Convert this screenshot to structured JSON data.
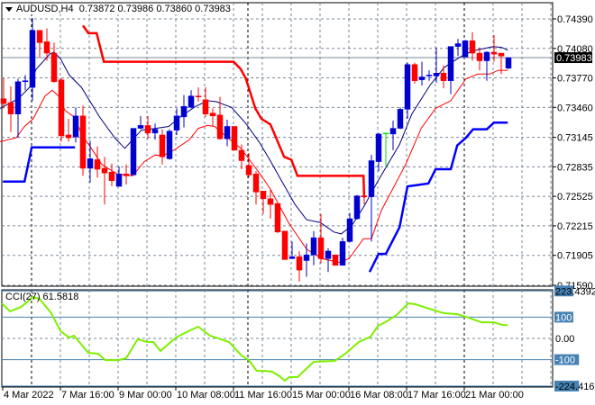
{
  "header": {
    "symbol": "AUDUSD,H4",
    "ohlc": "0.73872 0.73986 0.73860 0.73983"
  },
  "indicator": {
    "label": "CCI(27) 61.5818"
  },
  "colors": {
    "bull": "#0000c8",
    "bear": "#ff0000",
    "doji": "#00e000",
    "ma_upper": "#000080",
    "ma_lower": "#ff0000",
    "step_upper": "#ff0000",
    "step_lower": "#0000ff",
    "cci": "#7fef00",
    "levels": "#4682b4",
    "grid": "#7a8899",
    "price_line": "#7a8899"
  },
  "chart_data": [
    {
      "type": "candlestick",
      "title": "AUDUSD,H4",
      "ylim": [
        0.7159,
        0.7439
      ],
      "y_ticks": [
        "0.74390",
        "0.74080",
        "0.73770",
        "0.73460",
        "0.73145",
        "0.72835",
        "0.72525",
        "0.72215",
        "0.71905",
        "0.71590"
      ],
      "current_price": "0.73983",
      "x_tick_labels": [
        "4 Mar 2022",
        "7 Mar 16:00",
        "9 Mar 00:00",
        "10 Mar 08:00",
        "11 Mar 16:00",
        "15 Mar 00:00",
        "16 Mar 08:00",
        "17 Mar 16:00",
        "21 Mar 00:00"
      ],
      "x_tick_index": [
        0,
        8,
        16,
        24,
        32,
        40,
        48,
        56,
        64
      ],
      "day_separators_index": [
        4,
        34,
        64
      ],
      "candles_ohlc": [
        [
          0.7355,
          0.7377,
          0.7345,
          0.735
        ],
        [
          0.7351,
          0.7368,
          0.732,
          0.7339
        ],
        [
          0.7339,
          0.7376,
          0.7314,
          0.7373
        ],
        [
          0.7373,
          0.738,
          0.7364,
          0.7374
        ],
        [
          0.7367,
          0.744,
          0.7353,
          0.7427
        ],
        [
          0.7427,
          0.7427,
          0.7399,
          0.7414
        ],
        [
          0.7415,
          0.7429,
          0.7395,
          0.7403
        ],
        [
          0.7403,
          0.7414,
          0.7372,
          0.7373
        ],
        [
          0.7375,
          0.7377,
          0.731,
          0.7316
        ],
        [
          0.7317,
          0.7334,
          0.731,
          0.7314
        ],
        [
          0.7315,
          0.7346,
          0.7309,
          0.7337
        ],
        [
          0.7337,
          0.7348,
          0.7274,
          0.7282
        ],
        [
          0.7282,
          0.7311,
          0.7267,
          0.7292
        ],
        [
          0.7291,
          0.7305,
          0.7272,
          0.7281
        ],
        [
          0.7282,
          0.7294,
          0.7244,
          0.7277
        ],
        [
          0.7278,
          0.7287,
          0.7263,
          0.7269
        ],
        [
          0.7263,
          0.7284,
          0.7263,
          0.7276
        ],
        [
          0.7276,
          0.7286,
          0.7265,
          0.7274
        ],
        [
          0.7275,
          0.7324,
          0.7275,
          0.7324
        ],
        [
          0.7324,
          0.7337,
          0.7323,
          0.7327
        ],
        [
          0.7327,
          0.7337,
          0.7313,
          0.7319
        ],
        [
          0.7319,
          0.7329,
          0.7312,
          0.7323
        ],
        [
          0.7317,
          0.7323,
          0.7286,
          0.7294
        ],
        [
          0.7292,
          0.7323,
          0.7291,
          0.7321
        ],
        [
          0.7322,
          0.7345,
          0.7317,
          0.7337
        ],
        [
          0.7336,
          0.7359,
          0.7325,
          0.7347
        ],
        [
          0.7346,
          0.7364,
          0.7345,
          0.7358
        ],
        [
          0.7358,
          0.7367,
          0.7352,
          0.7357
        ],
        [
          0.7354,
          0.7367,
          0.7336,
          0.7339
        ],
        [
          0.734,
          0.7345,
          0.7326,
          0.7337
        ],
        [
          0.7338,
          0.7357,
          0.7312,
          0.7313
        ],
        [
          0.7313,
          0.7333,
          0.7305,
          0.7326
        ],
        [
          0.7326,
          0.7326,
          0.7301,
          0.7301
        ],
        [
          0.7301,
          0.7307,
          0.7281,
          0.729
        ],
        [
          0.7285,
          0.7298,
          0.7272,
          0.7275
        ],
        [
          0.7276,
          0.7279,
          0.7244,
          0.7257
        ],
        [
          0.7258,
          0.7258,
          0.7234,
          0.725
        ],
        [
          0.725,
          0.726,
          0.7229,
          0.7244
        ],
        [
          0.7245,
          0.7245,
          0.7214,
          0.7215
        ],
        [
          0.7216,
          0.7216,
          0.7186,
          0.7186
        ],
        [
          0.7187,
          0.7205,
          0.7187,
          0.7189
        ],
        [
          0.7189,
          0.7195,
          0.7163,
          0.7175
        ],
        [
          0.7185,
          0.7203,
          0.7168,
          0.7191
        ],
        [
          0.7191,
          0.7216,
          0.718,
          0.7209
        ],
        [
          0.7209,
          0.7234,
          0.7182,
          0.7187
        ],
        [
          0.7187,
          0.7198,
          0.7173,
          0.7195
        ],
        [
          0.7191,
          0.7191,
          0.718,
          0.718
        ],
        [
          0.718,
          0.7209,
          0.718,
          0.7205
        ],
        [
          0.7205,
          0.7235,
          0.7204,
          0.7229
        ],
        [
          0.7229,
          0.7254,
          0.7228,
          0.7253
        ],
        [
          0.7253,
          0.7253,
          0.7244,
          0.7252
        ],
        [
          0.7252,
          0.7296,
          0.7205,
          0.729
        ],
        [
          0.7289,
          0.7319,
          0.7279,
          0.7318
        ],
        [
          0.7319,
          0.7319,
          0.7283,
          0.7319
        ],
        [
          0.7318,
          0.7332,
          0.7301,
          0.7324
        ],
        [
          0.7324,
          0.7346,
          0.7323,
          0.7344
        ],
        [
          0.7344,
          0.7393,
          0.7334,
          0.7391
        ],
        [
          0.7391,
          0.7393,
          0.7371,
          0.7374
        ],
        [
          0.7375,
          0.7394,
          0.7369,
          0.7378
        ],
        [
          0.7379,
          0.7385,
          0.7374,
          0.738
        ],
        [
          0.7379,
          0.7409,
          0.7372,
          0.7382
        ],
        [
          0.7382,
          0.739,
          0.7366,
          0.7374
        ],
        [
          0.7374,
          0.741,
          0.736,
          0.741
        ],
        [
          0.741,
          0.7418,
          0.74,
          0.7413
        ],
        [
          0.7399,
          0.7417,
          0.7399,
          0.7416
        ],
        [
          0.7416,
          0.7425,
          0.7395,
          0.7403
        ],
        [
          0.7403,
          0.7409,
          0.7385,
          0.7395
        ],
        [
          0.7395,
          0.7405,
          0.7374,
          0.7404
        ],
        [
          0.7404,
          0.7422,
          0.7394,
          0.7402
        ],
        [
          0.7403,
          0.7403,
          0.7381,
          0.74
        ],
        [
          0.73872,
          0.73986,
          0.7386,
          0.73983
        ]
      ],
      "series": [
        {
          "name": "ma_upper",
          "points": [
            [
              -0.5,
              0.7345
            ],
            [
              2,
              0.7355
            ],
            [
              3.6,
              0.7367
            ],
            [
              4.5,
              0.7386
            ],
            [
              6.4,
              0.7402
            ],
            [
              7,
              0.7404
            ],
            [
              7.9,
              0.7397
            ],
            [
              9.1,
              0.738
            ],
            [
              10.8,
              0.7367
            ],
            [
              13.3,
              0.7336
            ],
            [
              15.4,
              0.7314
            ],
            [
              16.8,
              0.7303
            ],
            [
              19.1,
              0.7322
            ],
            [
              21.1,
              0.7324
            ],
            [
              22.9,
              0.7326
            ],
            [
              24.5,
              0.7336
            ],
            [
              26.6,
              0.7347
            ],
            [
              28.3,
              0.7353
            ],
            [
              29.5,
              0.7352
            ],
            [
              31.6,
              0.7346
            ],
            [
              33.6,
              0.7329
            ],
            [
              35.4,
              0.731
            ],
            [
              36.9,
              0.7291
            ],
            [
              38.3,
              0.7272
            ],
            [
              40.4,
              0.7244
            ],
            [
              42,
              0.7228
            ],
            [
              43.9,
              0.7225
            ],
            [
              45.8,
              0.7215
            ],
            [
              46.8,
              0.7213
            ],
            [
              48.3,
              0.7222
            ],
            [
              49.9,
              0.7241
            ],
            [
              52,
              0.727
            ],
            [
              54.9,
              0.7307
            ],
            [
              56.6,
              0.7339
            ],
            [
              59.1,
              0.7369
            ],
            [
              61.1,
              0.7388
            ],
            [
              63.3,
              0.7399
            ],
            [
              64.9,
              0.7405
            ],
            [
              66.1,
              0.7407
            ],
            [
              67.9,
              0.741
            ],
            [
              69.1,
              0.7409
            ],
            [
              69.9,
              0.7406
            ]
          ]
        },
        {
          "name": "ma_lower",
          "points": [
            [
              -0.5,
              0.731
            ],
            [
              1.75,
              0.7314
            ],
            [
              2.9,
              0.7326
            ],
            [
              4.1,
              0.7334
            ],
            [
              5.75,
              0.7358
            ],
            [
              6.75,
              0.7364
            ],
            [
              7.6,
              0.7358
            ],
            [
              8.5,
              0.7343
            ],
            [
              9.75,
              0.7336
            ],
            [
              11,
              0.7315
            ],
            [
              12,
              0.7305
            ],
            [
              13.6,
              0.7286
            ],
            [
              15.75,
              0.7276
            ],
            [
              17.9,
              0.7274
            ],
            [
              19.5,
              0.7289
            ],
            [
              21,
              0.7296
            ],
            [
              22,
              0.7295
            ],
            [
              23.6,
              0.7301
            ],
            [
              25.75,
              0.7312
            ],
            [
              27,
              0.7324
            ],
            [
              28.25,
              0.7327
            ],
            [
              29.25,
              0.7326
            ],
            [
              31.1,
              0.7314
            ],
            [
              32.9,
              0.7303
            ],
            [
              34.1,
              0.7291
            ],
            [
              35.75,
              0.7274
            ],
            [
              37,
              0.726
            ],
            [
              39.5,
              0.7225
            ],
            [
              42,
              0.7197
            ],
            [
              44.1,
              0.7187
            ],
            [
              46.6,
              0.7183
            ],
            [
              47.9,
              0.7187
            ],
            [
              49.9,
              0.7208
            ],
            [
              51,
              0.7208
            ],
            [
              52.4,
              0.7238
            ],
            [
              55.75,
              0.7286
            ],
            [
              57.9,
              0.7324
            ],
            [
              59.9,
              0.7345
            ],
            [
              62,
              0.7353
            ],
            [
              64.1,
              0.7376
            ],
            [
              65.75,
              0.7381
            ],
            [
              67.4,
              0.7381
            ],
            [
              68.6,
              0.7385
            ],
            [
              69.9,
              0.7385
            ]
          ]
        },
        {
          "name": "step_upper",
          "points": [
            [
              11,
              0.7432
            ],
            [
              11.75,
              0.7424
            ],
            [
              12.9,
              0.7424
            ],
            [
              13.9,
              0.7394
            ],
            [
              31.9,
              0.7394
            ],
            [
              32.9,
              0.7386
            ],
            [
              33.6,
              0.7376
            ],
            [
              34.9,
              0.7345
            ],
            [
              35.75,
              0.7334
            ],
            [
              37,
              0.7328
            ],
            [
              38.9,
              0.7294
            ],
            [
              39.9,
              0.7291
            ],
            [
              40.75,
              0.7274
            ],
            [
              49.9,
              0.7274
            ],
            [
              50,
              0.7251
            ]
          ]
        },
        {
          "name": "step_lower_a",
          "points": [
            [
              -0.1,
              0.7268
            ],
            [
              2.9,
              0.7268
            ],
            [
              3.9,
              0.7304
            ],
            [
              9.9,
              0.7304
            ]
          ]
        },
        {
          "name": "step_lower_b",
          "points": [
            [
              50.75,
              0.7173
            ],
            [
              52,
              0.7192
            ],
            [
              53,
              0.7192
            ],
            [
              54.9,
              0.722
            ],
            [
              56,
              0.7263
            ],
            [
              58.9,
              0.7266
            ],
            [
              59.9,
              0.7281
            ],
            [
              62,
              0.7281
            ],
            [
              62.9,
              0.7306
            ],
            [
              64.1,
              0.7314
            ],
            [
              65.1,
              0.7323
            ],
            [
              67,
              0.7323
            ],
            [
              68,
              0.733
            ],
            [
              69.9,
              0.733
            ]
          ]
        }
      ]
    },
    {
      "type": "line",
      "title": "CCI(27) 61.5818",
      "ylim": [
        -224.4167,
        223.4392
      ],
      "levels": [
        {
          "value": 223.4392,
          "label": "223.4392",
          "boxed": "223"
        },
        {
          "value": 100,
          "label": "100",
          "boxed": "100"
        },
        {
          "value": 0,
          "label": "0.00",
          "boxed": ""
        },
        {
          "value": -100,
          "label": "-100",
          "boxed": "-100"
        },
        {
          "value": -224.4167,
          "label": "-224.4167",
          "boxed": "-224"
        }
      ],
      "points": [
        [
          -0.25,
          165
        ],
        [
          0.9,
          127
        ],
        [
          2.4,
          148
        ],
        [
          3.4,
          174
        ],
        [
          4,
          195
        ],
        [
          5,
          186
        ],
        [
          6.6,
          119
        ],
        [
          7.9,
          34
        ],
        [
          9.1,
          4
        ],
        [
          9.75,
          13
        ],
        [
          11.75,
          -68
        ],
        [
          13.1,
          -72
        ],
        [
          14.1,
          -102
        ],
        [
          16,
          -102
        ],
        [
          17,
          -93
        ],
        [
          18.6,
          -4
        ],
        [
          19.9,
          -17
        ],
        [
          20.75,
          -17
        ],
        [
          21.75,
          -59
        ],
        [
          23.9,
          4
        ],
        [
          25.6,
          34
        ],
        [
          27,
          55
        ],
        [
          28.6,
          13
        ],
        [
          30.1,
          -4
        ],
        [
          31.25,
          -17
        ],
        [
          33,
          -81
        ],
        [
          34,
          -102
        ],
        [
          35.1,
          -153
        ],
        [
          36.4,
          -153
        ],
        [
          37.25,
          -157
        ],
        [
          38.25,
          -178
        ],
        [
          39,
          -199
        ],
        [
          39.6,
          -182
        ],
        [
          40.75,
          -182
        ],
        [
          43,
          -110
        ],
        [
          45.9,
          -106
        ],
        [
          47.4,
          -72
        ],
        [
          49.25,
          -17
        ],
        [
          50.9,
          8
        ],
        [
          51.9,
          59
        ],
        [
          52.9,
          76
        ],
        [
          54.5,
          110
        ],
        [
          56.1,
          165
        ],
        [
          57.1,
          161
        ],
        [
          59,
          140
        ],
        [
          61,
          119
        ],
        [
          62.9,
          114
        ],
        [
          64.5,
          97
        ],
        [
          66.25,
          76
        ],
        [
          67.9,
          76
        ],
        [
          69.1,
          64
        ],
        [
          69.9,
          61.58
        ]
      ]
    }
  ]
}
